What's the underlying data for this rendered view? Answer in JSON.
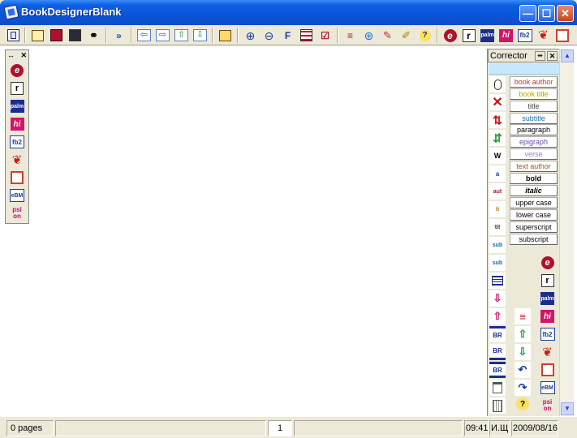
{
  "window": {
    "title": "BookDesignerBlank",
    "minimize_glyph": "—",
    "maximize_glyph": "☐",
    "close_glyph": "✕"
  },
  "toolbar": {
    "icons": [
      "document-icon",
      "open-book-icon",
      "save-red-icon",
      "save-icon",
      "binoculars-icon",
      "fast-forward-icon",
      "arrow-left-icon",
      "arrow-right-icon",
      "arrow-up-icon",
      "arrow-down-icon",
      "book-icon",
      "zoom-in-icon",
      "zoom-out-icon",
      "text-format-icon",
      "table-icon",
      "check-list-icon",
      "page-break-icon",
      "globe-icon",
      "brush-icon",
      "pencil-note-icon",
      "help-icon",
      "ebook-e-icon",
      "reader-r-icon",
      "palm-icon",
      "hi-icon",
      "fb2-icon",
      "red-cushion-icon",
      "pages-icon"
    ]
  },
  "left_panel": {
    "header_pin": "↔",
    "header_close": "✕",
    "items": [
      {
        "name": "ebook-e-icon",
        "label": "e"
      },
      {
        "name": "reader-r-icon",
        "label": "r"
      },
      {
        "name": "palm-icon",
        "label": "palm"
      },
      {
        "name": "hi-icon",
        "label": "hi"
      },
      {
        "name": "fb2-icon",
        "label": "fb2"
      },
      {
        "name": "red-cushion-icon",
        "label": ""
      },
      {
        "name": "pages-icon",
        "label": ""
      },
      {
        "name": "ebm-icon",
        "label": "eBM"
      },
      {
        "name": "psion-icon",
        "label": "psi on"
      }
    ]
  },
  "corrector": {
    "title": "Corrector",
    "pin_glyph": "⇹",
    "close_glyph": "✕",
    "style_buttons": [
      {
        "label": "book author",
        "color": "#c0392b"
      },
      {
        "label": "book title",
        "color": "#b7a000"
      },
      {
        "label": "title",
        "color": "#444444"
      },
      {
        "label": "subtitle",
        "color": "#1f6aa5"
      },
      {
        "label": "paragraph",
        "color": "#000000"
      },
      {
        "label": "epigraph",
        "color": "#6a4cae"
      },
      {
        "label": "verse",
        "color": "#9a7fcf"
      },
      {
        "label": "text author",
        "color": "#a0522d"
      },
      {
        "label": "bold",
        "color": "#000000"
      },
      {
        "label": "italic",
        "color": "#000000"
      },
      {
        "label": "upper case",
        "color": "#000000"
      },
      {
        "label": "lower case",
        "color": "#000000"
      },
      {
        "label": "superscript",
        "color": "#000000"
      },
      {
        "label": "subscript",
        "color": "#000000"
      }
    ],
    "left_icons": [
      {
        "name": "mouse-icon",
        "label": ""
      },
      {
        "name": "delete-x-icon",
        "label": "✕"
      },
      {
        "name": "sort-down-icon",
        "label": "⇅"
      },
      {
        "name": "sort-up-icon",
        "label": "⇵"
      },
      {
        "name": "wrap-icon",
        "label": "W"
      },
      {
        "name": "aa-swap-icon",
        "label": "a"
      },
      {
        "name": "aut-icon",
        "label": "aut"
      },
      {
        "name": "ti-icon",
        "label": "ti"
      },
      {
        "name": "tit-icon",
        "label": "tit"
      },
      {
        "name": "sub-sub-icon",
        "label": "sub"
      },
      {
        "name": "sub-tit-icon",
        "label": "sub"
      },
      {
        "name": "list-icon",
        "label": ""
      },
      {
        "name": "move-down-pink-icon",
        "label": "⇩"
      },
      {
        "name": "move-up-pink-icon",
        "label": "⇧"
      },
      {
        "name": "br-top-icon",
        "label": "BR"
      },
      {
        "name": "br-bottom-icon",
        "label": "BR"
      },
      {
        "name": "br-both-icon",
        "label": "BR"
      },
      {
        "name": "frame-icon",
        "label": ""
      },
      {
        "name": "grid-icon",
        "label": ""
      }
    ],
    "mid_icons": [
      {
        "name": "page-break-icon",
        "label": "≡"
      },
      {
        "name": "arrow-up-green-icon",
        "label": "⇧"
      },
      {
        "name": "arrow-down-green-icon",
        "label": "⇩"
      },
      {
        "name": "undo-icon",
        "label": "↶"
      },
      {
        "name": "redo-icon",
        "label": "↷"
      },
      {
        "name": "help-icon",
        "label": "?"
      }
    ],
    "right_icons": [
      {
        "name": "ebook-e-icon",
        "label": "e"
      },
      {
        "name": "reader-r-icon",
        "label": "r"
      },
      {
        "name": "palm-icon",
        "label": "palm"
      },
      {
        "name": "hi-icon",
        "label": "hi"
      },
      {
        "name": "fb2-icon",
        "label": "fb2"
      },
      {
        "name": "red-cushion-icon",
        "label": ""
      },
      {
        "name": "pages-icon",
        "label": ""
      },
      {
        "name": "ebm-icon",
        "label": "eBM"
      },
      {
        "name": "psion-icon",
        "label": "psi on"
      }
    ]
  },
  "scrollbar": {
    "up_glyph": "▲",
    "down_glyph": "▼"
  },
  "statusbar": {
    "pages": "0 pages",
    "page_number": "1",
    "time": "09:41",
    "layout": "И.Щ",
    "date": "2009/08/16"
  }
}
